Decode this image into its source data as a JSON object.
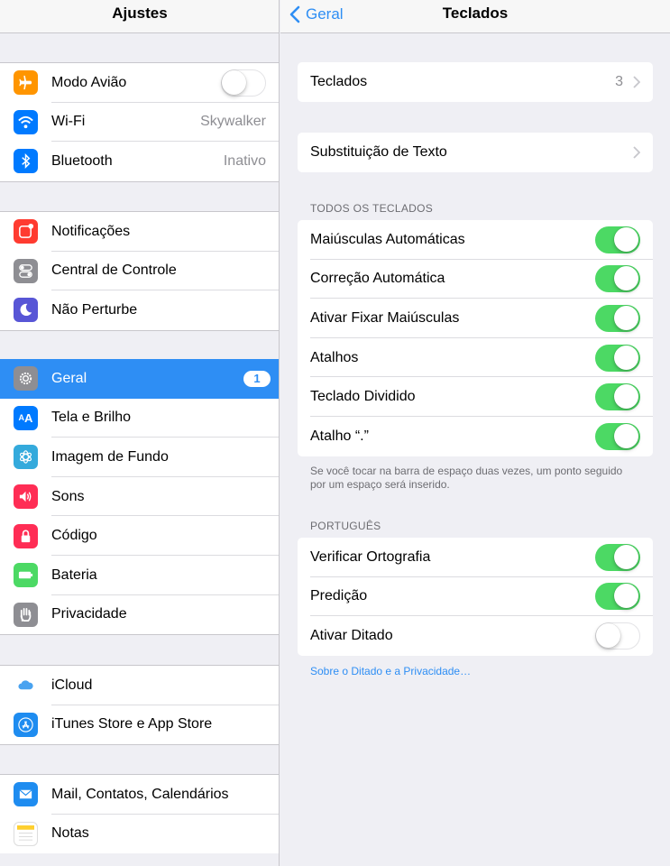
{
  "left": {
    "title": "Ajustes",
    "groups": [
      [
        {
          "label": "Modo Avião",
          "icon": "airplane-icon",
          "color": "#ff9500",
          "toggle": false
        },
        {
          "label": "Wi-Fi",
          "icon": "wifi-icon",
          "color": "#007aff",
          "value": "Skywalker"
        },
        {
          "label": "Bluetooth",
          "icon": "bluetooth-icon",
          "color": "#007aff",
          "value": "Inativo"
        }
      ],
      [
        {
          "label": "Notificações",
          "icon": "notifications-icon",
          "color": "#ff3b30"
        },
        {
          "label": "Central de Controle",
          "icon": "control-center-icon",
          "color": "#8e8e93"
        },
        {
          "label": "Não Perturbe",
          "icon": "moon-icon",
          "color": "#5856d6"
        }
      ],
      [
        {
          "label": "Geral",
          "icon": "gear-icon",
          "color": "#8e8e93",
          "badge": "1",
          "selected": true
        },
        {
          "label": "Tela e Brilho",
          "icon": "display-icon",
          "color": "#007aff"
        },
        {
          "label": "Imagem de Fundo",
          "icon": "wallpaper-icon",
          "color": "#34aadc"
        },
        {
          "label": "Sons",
          "icon": "speaker-icon",
          "color": "#ff2d55"
        },
        {
          "label": "Código",
          "icon": "lock-icon",
          "color": "#ff2d55"
        },
        {
          "label": "Bateria",
          "icon": "battery-icon",
          "color": "#4cd964"
        },
        {
          "label": "Privacidade",
          "icon": "hand-icon",
          "color": "#8e8e93"
        }
      ],
      [
        {
          "label": "iCloud",
          "icon": "icloud-icon",
          "color": "#ffffff"
        },
        {
          "label": "iTunes Store e App Store",
          "icon": "app-store-icon",
          "color": "#1e8cf0"
        }
      ],
      [
        {
          "label": "Mail, Contatos, Calendários",
          "icon": "mail-icon",
          "color": "#1e8cf0"
        },
        {
          "label": "Notas",
          "icon": "notes-icon",
          "color": "#ffffff"
        }
      ]
    ]
  },
  "right": {
    "back_label": "Geral",
    "title": "Teclados",
    "keyboards": {
      "label": "Teclados",
      "value": "3"
    },
    "text_replacement": {
      "label": "Substituição de Texto"
    },
    "all_keyboards_header": "TODOS OS TECLADOS",
    "all_keyboards": [
      {
        "label": "Maiúsculas Automáticas",
        "on": true
      },
      {
        "label": "Correção Automática",
        "on": true
      },
      {
        "label": "Ativar Fixar Maiúsculas",
        "on": true
      },
      {
        "label": "Atalhos",
        "on": true
      },
      {
        "label": "Teclado Dividido",
        "on": true
      },
      {
        "label": "Atalho “.”",
        "on": true
      }
    ],
    "all_keyboards_footer": "Se você tocar na barra de espaço duas vezes, um ponto seguido por um espaço será inserido.",
    "portuguese_header": "PORTUGUÊS",
    "portuguese": [
      {
        "label": "Verificar Ortografia",
        "on": true
      },
      {
        "label": "Predição",
        "on": true
      },
      {
        "label": "Ativar Ditado",
        "on": false
      }
    ],
    "dictation_link": "Sobre o Ditado e a Privacidade…"
  },
  "colors": {
    "accent": "#2e8ef4",
    "toggle_on": "#4cd964"
  }
}
